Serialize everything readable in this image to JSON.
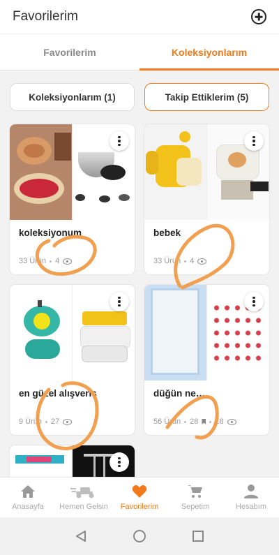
{
  "header": {
    "title": "Favorilerim"
  },
  "tabs": [
    {
      "label": "Favorilerim",
      "active": false
    },
    {
      "label": "Koleksiyonlarım",
      "active": true
    }
  ],
  "filters": {
    "my_collections": "Koleksiyonlarım (1)",
    "following": "Takip Ettiklerim (5)"
  },
  "collections": [
    {
      "name": "koleksiyonum",
      "product_count": "33 Ürün",
      "views": "4"
    },
    {
      "name": "bebek",
      "product_count": "33 Ürün",
      "views": "4"
    },
    {
      "name": "en güzel alışveriş",
      "product_count": "9 Ürün",
      "views": "27"
    },
    {
      "name": "düğün ne…",
      "product_count": "56 Ürün",
      "saves": "28",
      "views": "18"
    }
  ],
  "bottom_nav": [
    {
      "label": "Anasayfa",
      "icon": "home-icon"
    },
    {
      "label": "Hemen Gelsin",
      "icon": "scooter-icon"
    },
    {
      "label": "Favorilerim",
      "icon": "heart-icon",
      "active": true
    },
    {
      "label": "Sepetim",
      "icon": "cart-icon"
    },
    {
      "label": "Hesabım",
      "icon": "user-icon"
    }
  ],
  "colors": {
    "accent": "#f27a1a",
    "annotation": "#f0a050"
  }
}
